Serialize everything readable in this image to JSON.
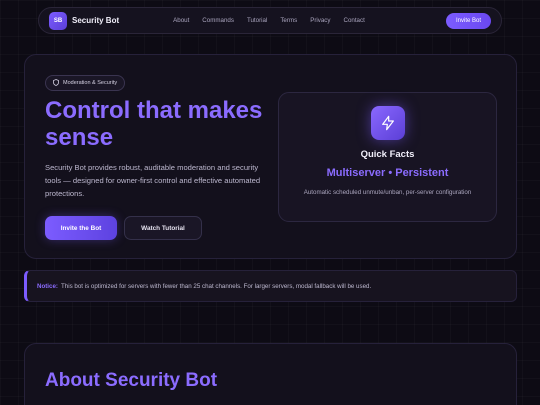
{
  "nav": {
    "logo_text": "SB",
    "brand": "Security Bot",
    "links": [
      "About",
      "Commands",
      "Tutorial",
      "Terms",
      "Privacy",
      "Contact"
    ],
    "invite_label": "Invite Bot"
  },
  "hero": {
    "pill_icon": "shield-icon",
    "pill_label": "Moderation & Security",
    "headline": "Control that makes sense",
    "description": "Security Bot provides robust, auditable moderation and security tools — designed for owner-first control and effective automated protections.",
    "primary_button": "Invite the Bot",
    "secondary_button": "Watch Tutorial"
  },
  "facts": {
    "icon": "lightning-icon",
    "title": "Quick Facts",
    "main": "Multiserver • Persistent",
    "sub": "Automatic scheduled unmute/unban, per-server configuration"
  },
  "notice": {
    "label": "Notice:",
    "text": "This bot is optimized for servers with fewer than 25 chat channels. For larger servers, modal fallback will be used."
  },
  "about": {
    "title": "About Security Bot"
  },
  "colors": {
    "accent": "#7c5cff",
    "background": "#0d0b14"
  }
}
